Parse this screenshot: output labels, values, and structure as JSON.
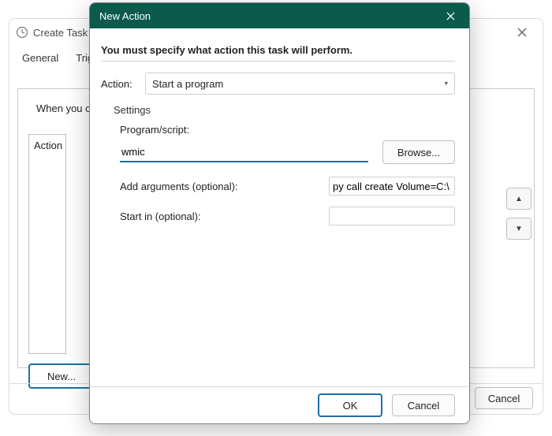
{
  "parent": {
    "title": "Create Task",
    "tabs": [
      "General",
      "Triggers"
    ],
    "when_label": "When you c",
    "list_header": "Action",
    "new_button": "New...",
    "cancel_button": "Cancel"
  },
  "dialog": {
    "title": "New Action",
    "instruction": "You must specify what action this task will perform.",
    "action_label": "Action:",
    "action_value": "Start a program",
    "settings_heading": "Settings",
    "program_label": "Program/script:",
    "program_value": "wmic",
    "browse_label": "Browse...",
    "args_label": "Add arguments (optional):",
    "args_value": "py call create Volume=C:\\",
    "startin_label": "Start in (optional):",
    "startin_value": "",
    "ok_label": "OK",
    "cancel_label": "Cancel"
  }
}
